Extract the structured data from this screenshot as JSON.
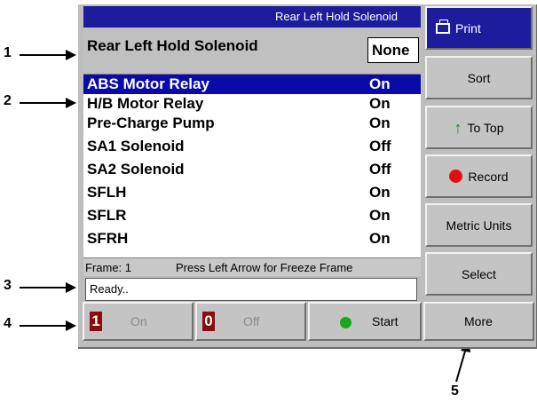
{
  "callouts": [
    "1",
    "2",
    "3",
    "4",
    "5"
  ],
  "title_bar": "Rear Left Hold Solenoid",
  "selected_pid": {
    "name": "Rear Left Hold Solenoid",
    "value": "None"
  },
  "pid_list": [
    {
      "name": "ABS Motor Relay",
      "value": "On",
      "selected": true
    },
    {
      "name": "H/B Motor Relay",
      "value": "On"
    },
    {
      "name": "Pre-Charge Pump",
      "value": "On"
    },
    {
      "name": "SA1 Solenoid",
      "value": "Off"
    },
    {
      "name": "SA2 Solenoid",
      "value": "Off"
    },
    {
      "name": "SFLH",
      "value": "On"
    },
    {
      "name": "SFLR",
      "value": "On"
    },
    {
      "name": "SFRH",
      "value": "On"
    }
  ],
  "frame_bar": {
    "frame": "Frame: 1",
    "hint": "Press Left Arrow for Freeze Frame"
  },
  "status": "Ready..",
  "side_buttons": {
    "print": "Print",
    "sort": "Sort",
    "to_top": "To Top",
    "record": "Record",
    "metric_units": "Metric Units",
    "select": "Select"
  },
  "bottom_buttons": {
    "on": {
      "digit": "1",
      "label": "On"
    },
    "off": {
      "digit": "0",
      "label": "Off"
    },
    "start": "Start",
    "more": "More"
  },
  "colors": {
    "title_bar": "#1c1c9c",
    "selected_row": "#0a0aa8",
    "digit_icon": "#8a0c0c",
    "record_dot": "#e01010",
    "start_dot": "#1aa51a"
  }
}
